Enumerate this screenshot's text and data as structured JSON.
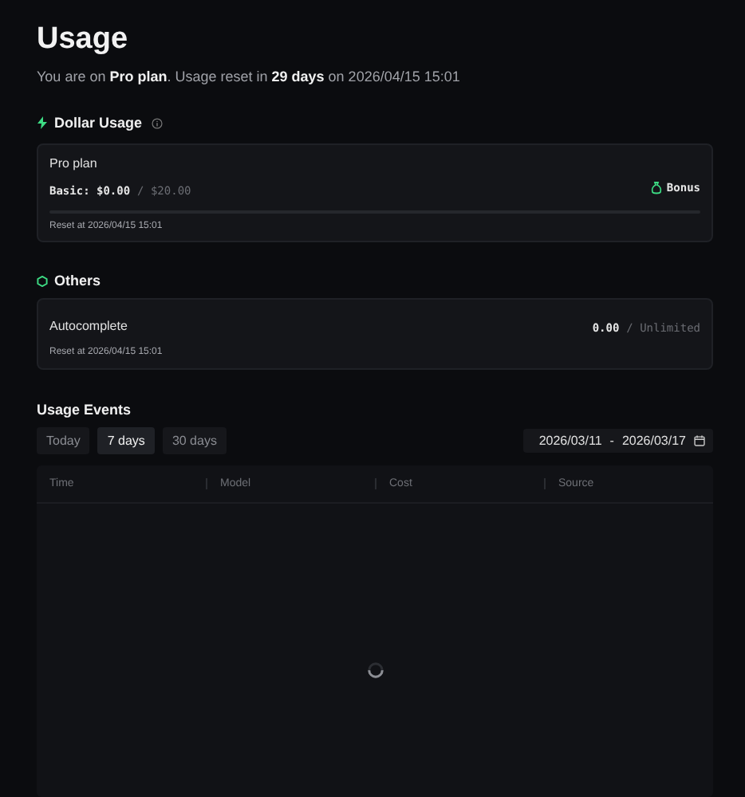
{
  "title": "Usage",
  "subtitle": "You are on **Pro plan**. Usage reset in **29 days** on 2026/04/15 15:01",
  "dollar_usage": {
    "heading": "Dollar Usage",
    "card": {
      "name": "Pro plan",
      "used_label": "Basic: $0.00",
      "limit": "/ $20.00",
      "bonus": "Bonus",
      "level": 0,
      "reset": "Reset at 2026/04/15 15:01"
    }
  },
  "others": {
    "heading": "Others",
    "items": [
      {
        "name": "Autocomplete",
        "used": "0.00",
        "limit": "/ Unlimited",
        "reset": "Reset at 2026/04/15 15:01"
      }
    ]
  },
  "usage_events": {
    "heading": "Usage Events",
    "tabs": [
      {
        "label": "Today",
        "selected": false
      },
      {
        "label": "7 days",
        "selected": true
      },
      {
        "label": "30 days",
        "selected": false
      }
    ],
    "date_range": {
      "start": "2026/03/11",
      "separator": "-",
      "end": "2026/03/17"
    },
    "table": {
      "columns": [
        "Time",
        "Model",
        "Cost",
        "Source"
      ],
      "loading": true
    }
  }
}
